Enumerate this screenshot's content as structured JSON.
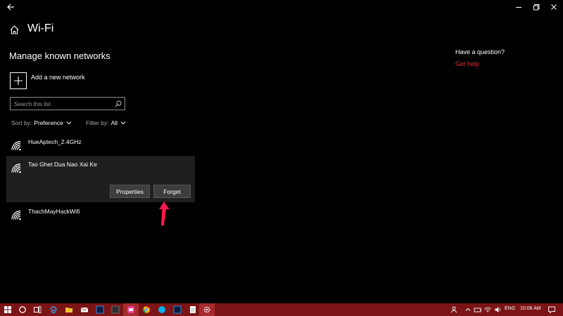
{
  "window": {
    "back_icon": "back-arrow-icon",
    "controls": [
      "minimize-icon",
      "restore-icon",
      "close-icon"
    ]
  },
  "header": {
    "home_icon": "home-icon",
    "title": "Wi-Fi"
  },
  "main": {
    "section_title": "Manage known networks",
    "add_label": "Add a new network",
    "search": {
      "placeholder": "Search this list"
    },
    "sort": {
      "label": "Sort by:",
      "value": "Preference"
    },
    "filter": {
      "label": "Filter by:",
      "value": "All"
    },
    "networks": [
      {
        "name": "HueAptech_2.4GHz"
      },
      {
        "name": "Tao Ghet Dua Nao Xai Ke",
        "selected": true
      },
      {
        "name": "ThachMayHackWifi"
      }
    ],
    "actions": {
      "properties": "Properties",
      "forget": "Forget"
    }
  },
  "side": {
    "question": "Have a question?",
    "link": "Get help"
  },
  "annotation": {
    "color": "#ff1a4a"
  },
  "taskbar": {
    "background": "#7a1416",
    "language": "ENG",
    "time": "10:06 AM"
  },
  "colors": {
    "accent": "#e0303a"
  }
}
